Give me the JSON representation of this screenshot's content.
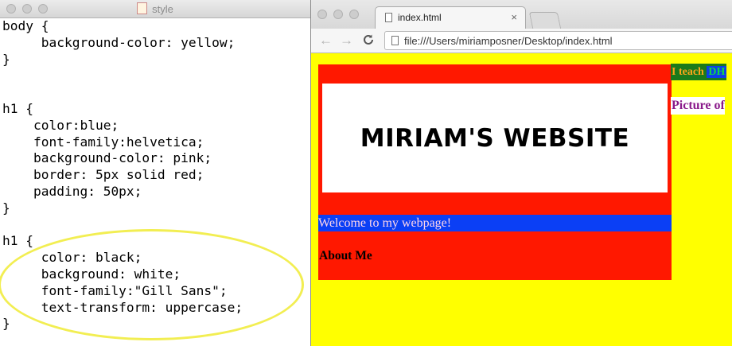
{
  "editor": {
    "title": "style",
    "code": "body {\n     background-color: yellow;\n}\n\n\nh1 {\n    color:blue;\n    font-family:helvetica;\n    background-color: pink;\n    border: 5px solid red;\n    padding: 50px;\n}\n\nh1 {\n     color: black;\n     background: white;\n     font-family:\"Gill Sans\";\n     text-transform: uppercase;\n}",
    "highlight_color": "#f2ee52"
  },
  "browser": {
    "tab_title": "index.html",
    "tab_close": "×",
    "url": "file:///Users/miriamposner/Desktop/index.html",
    "nav": {
      "back": "←",
      "forward": "→",
      "reload": "C"
    },
    "page": {
      "heading": "MIRIAM'S WEBSITE",
      "welcome": "Welcome to my webpage!",
      "about": "About Me",
      "teach_prefix": "I teach ",
      "teach_highlight": "DH",
      "picture": "Picture of",
      "colors": {
        "background": "#ffff00",
        "red": "#ff1800",
        "blue": "#0b3ff5"
      }
    }
  }
}
